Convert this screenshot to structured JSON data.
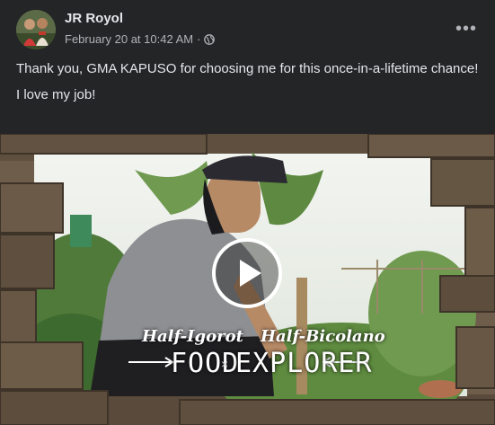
{
  "post": {
    "author": "JR Royol",
    "timestamp": "February 20 at 10:42 AM",
    "separator": "·",
    "privacy_icon": "globe-icon",
    "more_label": "•••",
    "text_lines": [
      "Thank you, GMA KAPUSO for choosing me for this once-in-a-lifetime chance!",
      "I love my job!"
    ]
  },
  "video": {
    "caption_left": "Half-Igorot",
    "caption_right": "Half-Bicolano",
    "title_food": "FOOD",
    "title_cross": "×",
    "title_explorer": "EXPLORER",
    "play_icon": "play-icon"
  },
  "colors": {
    "background": "#242526",
    "text_primary": "#e4e6eb",
    "text_secondary": "#b0b3b8"
  }
}
